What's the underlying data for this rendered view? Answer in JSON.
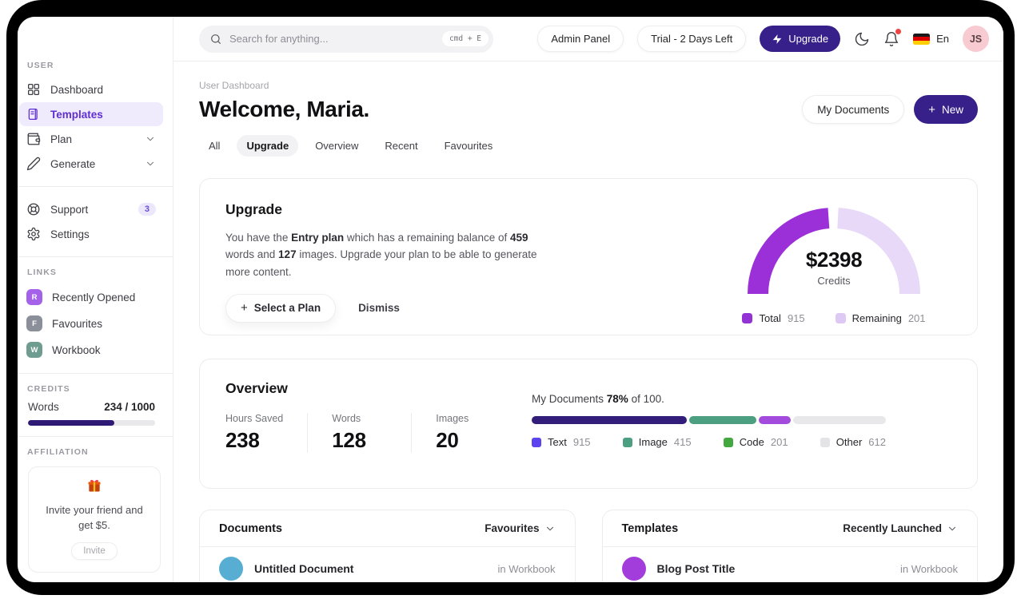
{
  "colors": {
    "indigo": "#37208a",
    "indigo_dark": "#2e1a74",
    "accent_purple": "#5f2ed2",
    "active_item_bg": "#f0ebfc",
    "flag_top": "#1a1a1a",
    "flag_mid": "#dd0000",
    "flag_bot": "#ffce00",
    "avatar_bg": "#f7cbd1",
    "avatar_text": "#5c4242"
  },
  "sidebar": {
    "section_user": "USER",
    "section_links": "LINKS",
    "section_credits": "CREDITS",
    "section_affiliation": "AFFILIATION",
    "nav": {
      "dashboard": "Dashboard",
      "templates": "Templates",
      "plan": "Plan",
      "generate": "Generate",
      "support": "Support",
      "support_badge": "3",
      "settings": "Settings"
    },
    "links": [
      {
        "initial": "R",
        "label": "Recently Opened",
        "color": "#a362e8"
      },
      {
        "initial": "F",
        "label": "Favourites",
        "color": "#8a8f9a"
      },
      {
        "initial": "W",
        "label": "Workbook",
        "color": "#6f9c90"
      }
    ],
    "credits": {
      "label": "Words",
      "value": "234 / 1000",
      "fill": "68%"
    },
    "affiliation": {
      "text": "Invite your friend and get $5.",
      "button": "Invite"
    }
  },
  "topbar": {
    "search_placeholder": "Search for anything...",
    "shortcut": "cmd + E",
    "admin": "Admin Panel",
    "trial": "Trial - 2 Days Left",
    "upgrade": "Upgrade",
    "lang": "En",
    "avatar": "JS"
  },
  "header": {
    "breadcrumb": "User Dashboard",
    "title": "Welcome, Maria.",
    "my_documents": "My Documents",
    "new_label": "New",
    "plus": "+",
    "tabs": [
      "All",
      "Upgrade",
      "Overview",
      "Recent",
      "Favourites"
    ],
    "active_tab": "Upgrade"
  },
  "upgrade": {
    "title": "Upgrade",
    "p1": "You have the ",
    "plan": "Entry plan",
    "p2": " which has a remaining balance of ",
    "words": "459",
    "p3": " words and ",
    "images": "127",
    "p4": " images. Upgrade your plan to be able to generate more content.",
    "select_plan": "Select a Plan",
    "plus": "+",
    "dismiss": "Dismiss",
    "gauge": {
      "value": "$2398",
      "label": "Credits",
      "total_label": "Total",
      "total_value": "915",
      "remaining_label": "Remaining",
      "remaining_value": "201",
      "total_color": "#9b30d9",
      "remaining_color": "#e7d9f7",
      "legend_total_color": "#9333d6",
      "legend_remaining_color": "#ddc9f3"
    }
  },
  "overview": {
    "title": "Overview",
    "stats": [
      {
        "label": "Hours Saved",
        "value": "238"
      },
      {
        "label": "Words",
        "value": "128"
      },
      {
        "label": "Images",
        "value": "20"
      }
    ],
    "docs_p1": "My Documents ",
    "docs_pct": "78%",
    "docs_p2": " of 100.",
    "bar": [
      {
        "name": "Text",
        "value": "915",
        "width": "43.7%",
        "bar_color": "#321d7a",
        "legend_color": "#5b43ee"
      },
      {
        "name": "Image",
        "value": "415",
        "width": "19%",
        "bar_color": "#4d9f82",
        "legend_color": "#4d9f82"
      },
      {
        "name": "Code",
        "value": "201",
        "width": "9.2%",
        "bar_color": "#a34bdc",
        "legend_color": "#43a83f"
      },
      {
        "name": "Other",
        "value": "612",
        "width": "",
        "bar_color": "#e8e8eb",
        "legend_color": "#e4e4e7"
      }
    ]
  },
  "documents": {
    "title": "Documents",
    "filter": "Favourites",
    "row": {
      "name": "Untitled Document",
      "location": "in Workbook",
      "avatar_color": "#58aed2"
    }
  },
  "templates": {
    "title": "Templates",
    "filter": "Recently Launched",
    "row": {
      "name": "Blog Post Title",
      "location": "in Workbook",
      "avatar_color": "#a23ddb"
    }
  },
  "chart_data": [
    {
      "type": "pie",
      "subtype": "half-donut-gauge",
      "title": "Credits",
      "center_value": "$2398",
      "series": [
        {
          "name": "Total",
          "value": 915
        },
        {
          "name": "Remaining",
          "value": 201
        }
      ],
      "visual_fractions": {
        "Total": 0.48,
        "Remaining": 0.52
      },
      "legend_position": "bottom"
    },
    {
      "type": "bar",
      "subtype": "horizontal-stacked-progress",
      "title": "My Documents 78% of 100.",
      "categories": [
        "Text",
        "Image",
        "Code",
        "Other"
      ],
      "values": [
        915,
        415,
        201,
        612
      ],
      "visual_fractions": [
        0.437,
        0.19,
        0.092,
        0.281
      ],
      "legend_position": "bottom"
    }
  ]
}
